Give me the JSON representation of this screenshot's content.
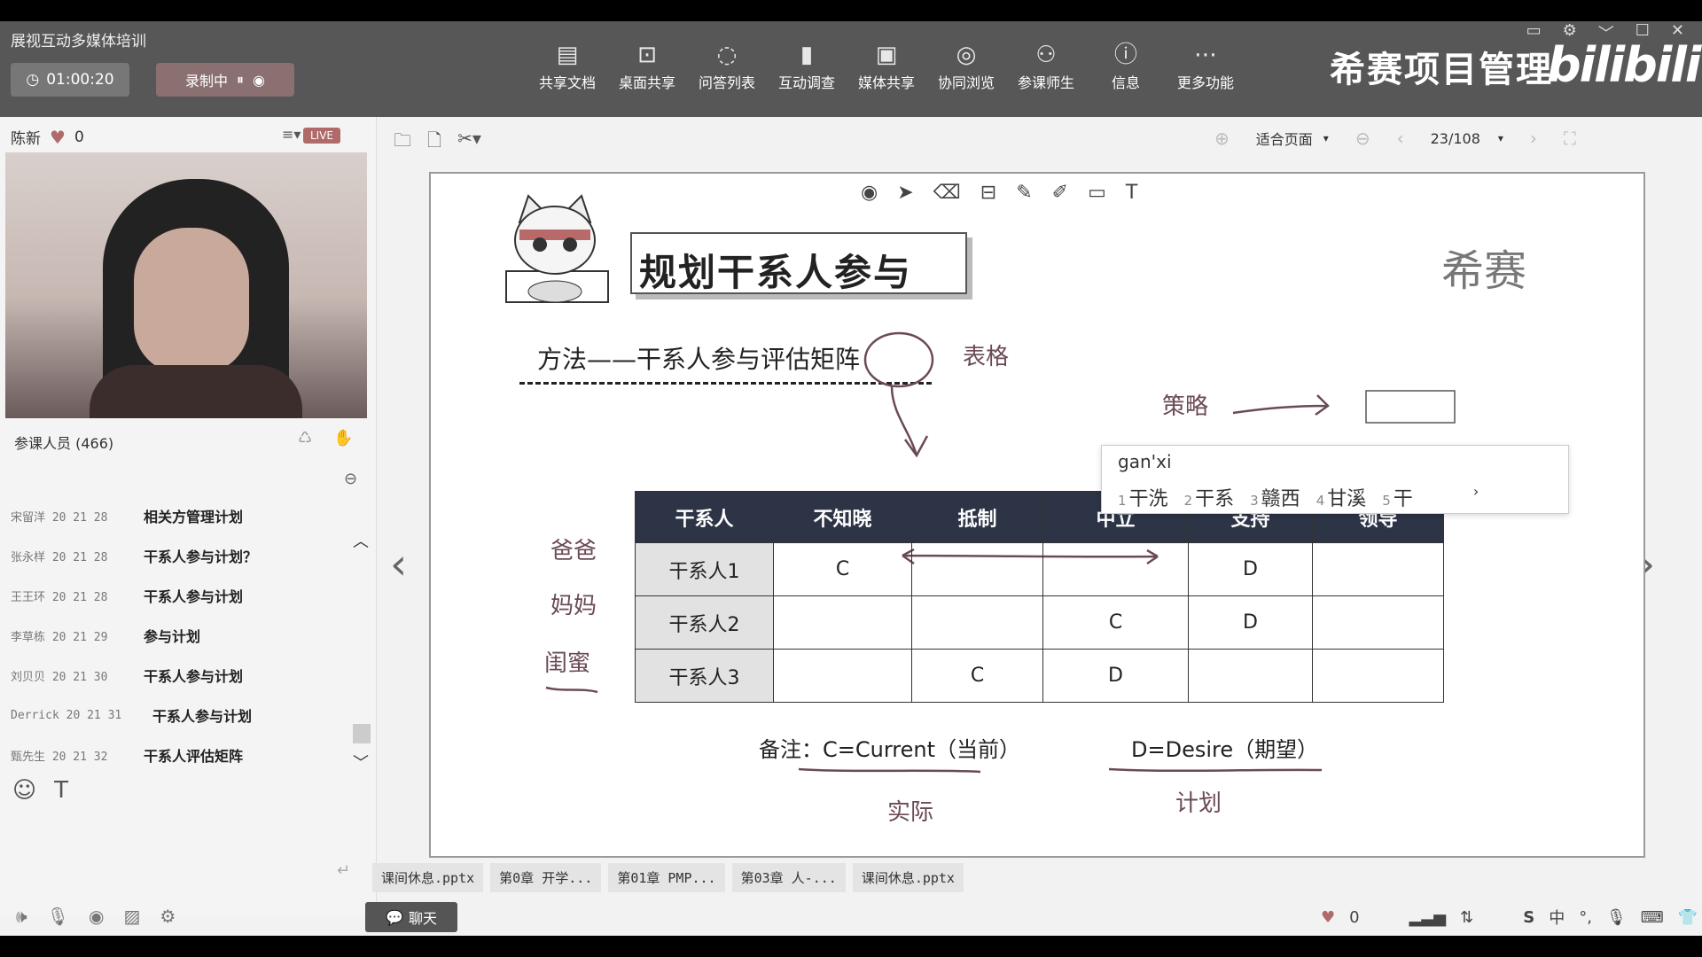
{
  "window": {
    "title": "展视互动多媒体培训",
    "timer": "01:00:20",
    "recording_label": "录制中"
  },
  "toolbar": [
    {
      "label": "共享文档",
      "icon": "▤"
    },
    {
      "label": "桌面共享",
      "icon": "⊡"
    },
    {
      "label": "问答列表",
      "icon": "◌"
    },
    {
      "label": "互动调查",
      "icon": "▮"
    },
    {
      "label": "媒体共享",
      "icon": "▣"
    },
    {
      "label": "协同浏览",
      "icon": "◎"
    },
    {
      "label": "参课师生",
      "icon": "⚇"
    },
    {
      "label": "信息",
      "icon": "ⓘ"
    },
    {
      "label": "更多功能",
      "icon": "⋯"
    }
  ],
  "brand": {
    "text": "希赛项目管理",
    "logo": "bilibili"
  },
  "presenter": {
    "name": "陈新",
    "likes": "0",
    "live_badge": "LIVE"
  },
  "attendees_label": "参课人员 (466)",
  "chat": [
    {
      "name": "宋留洋 20 21 28",
      "msg": "相关方管理计划"
    },
    {
      "name": "张永样 20 21 28",
      "msg": "干系人参与计划？"
    },
    {
      "name": "王王环 20 21 28",
      "msg": "干系人参与计划"
    },
    {
      "name": "李草栋 20 21 29",
      "msg": "参与计划"
    },
    {
      "name": "刘贝贝 20 21 30",
      "msg": "干系人参与计划"
    },
    {
      "name": "Derrick 20 21 31",
      "msg": "干系人参与计划"
    },
    {
      "name": "甄先生 20 21 32",
      "msg": "干系人评估矩阵"
    }
  ],
  "doc_toolbar": {
    "fit": "适合页面",
    "page": "23/108"
  },
  "slide": {
    "title": "规划干系人参与",
    "logo": "希赛",
    "method": "方法——干系人参与评估矩阵",
    "handwritten": {
      "table_word": "表格",
      "strategy": "策略",
      "dad": "爸爸",
      "mom": "妈妈",
      "bestie": "闺蜜",
      "actual": "实际",
      "plan": "计划"
    },
    "table": {
      "headers": [
        "干系人",
        "不知晓",
        "抵制",
        "中立",
        "支持",
        "领导"
      ],
      "rows": [
        [
          "干系人1",
          "C",
          "",
          "",
          "D",
          ""
        ],
        [
          "干系人2",
          "",
          "",
          "C",
          "D",
          ""
        ],
        [
          "干系人3",
          "",
          "C",
          "D",
          "",
          ""
        ]
      ]
    },
    "note_current": "备注：C=Current（当前）",
    "note_desire": "D=Desire（期望）"
  },
  "ime": {
    "input": "gan'xi",
    "candidates": [
      {
        "n": "1",
        "w": "干洗"
      },
      {
        "n": "2",
        "w": "干系"
      },
      {
        "n": "3",
        "w": "赣西"
      },
      {
        "n": "4",
        "w": "甘溪"
      },
      {
        "n": "5",
        "w": "干"
      }
    ]
  },
  "file_tabs": [
    "课间休息.pptx",
    "第0章 开学...",
    "第01章 PMP...",
    "第03章 人-...",
    "课间休息.pptx"
  ],
  "bottom": {
    "chat_button": "聊天",
    "likes": "0",
    "lang": "中"
  }
}
